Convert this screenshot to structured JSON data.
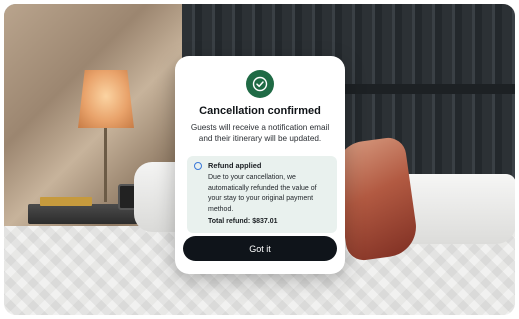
{
  "dialog": {
    "title": "Cancellation confirmed",
    "message": "Guests will receive a notification email and their itinerary will be updated.",
    "refund": {
      "title": "Refund applied",
      "body": "Due to your cancellation, we automatically refunded the value of your stay to your original payment method.",
      "total": "Total refund: $837.01"
    },
    "button_label": "Got it",
    "icons": {
      "status": "check-circle-icon",
      "refund": "info-circle-icon"
    }
  },
  "colors": {
    "success": "#1f6a45",
    "button_bg": "#0f141a",
    "refund_bg": "#e9f1ee",
    "info_icon": "#3a78d8"
  }
}
